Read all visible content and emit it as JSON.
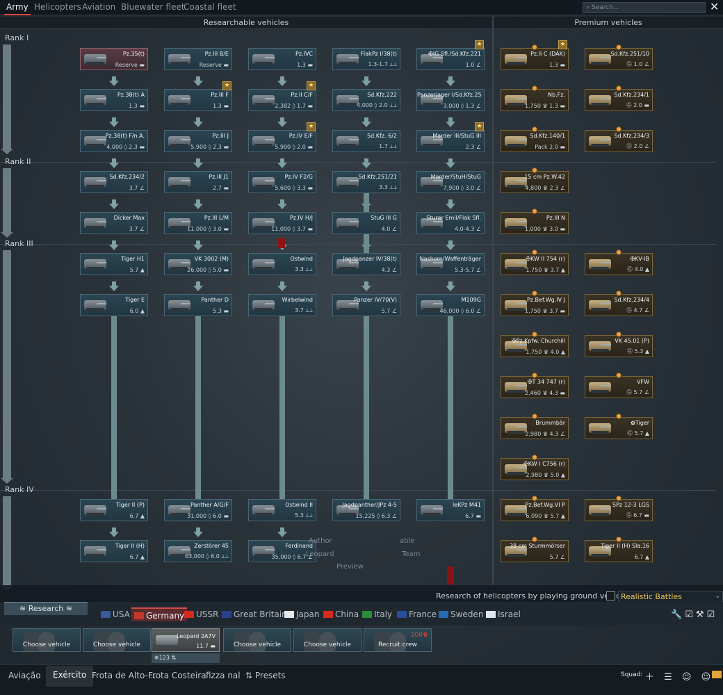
{
  "top_tabs": [
    {
      "label": "Army",
      "active": true
    },
    {
      "label": "Helicopters",
      "active": false
    },
    {
      "label": "Aviation",
      "active": false
    },
    {
      "label": "Bluewater fleet",
      "active": false
    },
    {
      "label": "Coastal fleet",
      "active": false
    }
  ],
  "search_placeholder": "Search...",
  "close_icon": "close-icon",
  "sections": {
    "researchable": "Researchable vehicles",
    "premium": "Premium vehicles"
  },
  "ranks": [
    "Rank I",
    "Rank II",
    "Rank III",
    "Rank IV"
  ],
  "tech_tree": [
    {
      "name": "Pz.35(t)",
      "stats": "Reserve ▬",
      "style": "reserve"
    },
    {
      "name": "Pz.III B/E",
      "stats": "Reserve ▬"
    },
    {
      "name": "Pz.IVC",
      "stats": "1.3 ▬"
    },
    {
      "name": "FlakPz I/38(t)",
      "stats": "1.3-1.7 ⟂⟂"
    },
    {
      "name": "✠IG Sfl./Sd.Kfz.221",
      "stats": "1.0 ∠",
      "badge": true
    },
    {
      "name": "Pz.38(t) A",
      "stats": "1.3 ▬"
    },
    {
      "name": "Pz.III F",
      "stats": "1.3 ▬",
      "badge": true
    },
    {
      "name": "Pz.II C/F",
      "stats": "2,382 ◊ 1.7 ▬",
      "badge": true
    },
    {
      "name": "Sd.Kfz.222",
      "stats": "4,000 ◊ 2.0 ⟂⟂"
    },
    {
      "name": "Panzerjager I/Sd.Kfz.25",
      "stats": "3,000 ◊ 1.3 ∠"
    },
    {
      "name": "Pz.38(t) F/n.A.",
      "stats": "4,000 ◊ 2.3 ▬"
    },
    {
      "name": "Pz.III J",
      "stats": "5,900 ◊ 2.3 ▬"
    },
    {
      "name": "Pz.IV E/F",
      "stats": "5,900 ◊ 2.0 ▬",
      "badge": true
    },
    {
      "name": "Sd.Kfz. 6/2",
      "stats": "1.7 ⟂⟂"
    },
    {
      "name": "Marder III/StuG III",
      "stats": "2.3 ∠",
      "badge": true
    },
    {
      "name": "Sd.Kfz.234/2",
      "stats": "3.7 ∠"
    },
    {
      "name": "Pz.III J1",
      "stats": "2.7 ▬"
    },
    {
      "name": "Pz.IV F2/G",
      "stats": "5,600 ◊ 3.3 ▬"
    },
    {
      "name": "Sd.Kfz.251/21",
      "stats": "3.3 ⟂⟂"
    },
    {
      "name": "Marder/StuH/StuG",
      "stats": "7,900 ◊ 3.0 ∠"
    },
    {
      "name": "Dicker Max",
      "stats": "3.7 ∠"
    },
    {
      "name": "Pz.III L/M",
      "stats": "11,000 ◊ 3.0 ▬"
    },
    {
      "name": "Pz.IV H/J",
      "stats": "11,000 ◊ 3.7 ▬"
    },
    {
      "name": "StuG III G",
      "stats": "4.0 ∠"
    },
    {
      "name": "Sturer Emil/Flak Sfl.",
      "stats": "4.0-4.3 ∠"
    },
    {
      "name": "Tiger H1",
      "stats": "5.7 ▲"
    },
    {
      "name": "VK 3002 (M)",
      "stats": "26,000 ◊ 5.0 ▬"
    },
    {
      "name": "Ostwind",
      "stats": "3.3 ⟂⟂"
    },
    {
      "name": "Jagdpanzer IV/38(t)",
      "stats": "4.3 ∠"
    },
    {
      "name": "Nashorn/Waffenträger",
      "stats": "5.3-5.7 ∠"
    },
    {
      "name": "Tiger E",
      "stats": "6.0 ▲"
    },
    {
      "name": "Panther D",
      "stats": "5.3 ▬"
    },
    {
      "name": "Wirbelwind",
      "stats": "3.7 ⟂⟂"
    },
    {
      "name": "Panzer IV/70(V)",
      "stats": "5.7 ∠"
    },
    {
      "name": "M109G",
      "stats": "46,000 ◊ 6.0 ∠"
    },
    {
      "name": "Tiger II (P)",
      "stats": "6.7 ▲"
    },
    {
      "name": "Panther A/G/F",
      "stats": "31,000 ◊ 6.0 ▬"
    },
    {
      "name": "Ostwind II",
      "stats": "5.3 ⟂⟂"
    },
    {
      "name": "Jagdpanther/JPz 4-5",
      "stats": "15,225 ◊ 6.3 ∠"
    },
    {
      "name": "leKPz M41",
      "stats": "6.7 ▬"
    },
    {
      "name": "Tiger II (H)",
      "stats": "6.7 ▲"
    },
    {
      "name": "Zerstörer 45",
      "stats": "63,000 ◊ 6.0 ⟂⟂"
    },
    {
      "name": "Ferdinand",
      "stats": "35,000 ◊ 6.7 ∠"
    }
  ],
  "premium": [
    {
      "name": "Pz.II C (DAK)",
      "stats": "1.3 ▬",
      "badge": true
    },
    {
      "name": "Sd.Kfz.251/10",
      "stats": "Ⓖ 1.0 ∠"
    },
    {
      "name": "Nb.Fz.",
      "stats": "1,750 ♛ 1.3 ▬"
    },
    {
      "name": "Sd.Kfz.234/1",
      "stats": "Ⓖ 2.0 ▬"
    },
    {
      "name": "Sd.Kfz.140/1",
      "stats": "Pack 2.0 ▬"
    },
    {
      "name": "Sd.Kfz.234/3",
      "stats": "Ⓖ 2.0 ∠"
    },
    {
      "name": "15 cm Pz.W.42",
      "stats": "4,800 ♛ 2.3 ∠"
    },
    {
      "name": "Pz.III N",
      "stats": "1,000 ♛ 3.0 ▬"
    },
    {
      "name": "✠KW II 754 (r)",
      "stats": "1,750 ♛ 3.7 ▲"
    },
    {
      "name": "✠KV-IB",
      "stats": "Ⓖ 4.0 ▲"
    },
    {
      "name": "Pz.Bef.Wg.IV J",
      "stats": "1,750 ♛ 3.7 ▬"
    },
    {
      "name": "Sd.Kfz.234/4",
      "stats": "Ⓖ 4.7 ∠"
    },
    {
      "name": "✠Pz.Kpfw. Churchill",
      "stats": "1,750 ♛ 4.0 ▲"
    },
    {
      "name": "VK 45.01 (P)",
      "stats": "Ⓖ 5.3 ▲"
    },
    {
      "name": "✠T 34 747 (r)",
      "stats": "2,460 ♛ 4.3 ▬"
    },
    {
      "name": "VFW",
      "stats": "Ⓖ 5.7 ∠"
    },
    {
      "name": "Brummbär",
      "stats": "2,980 ♛ 4.3 ∠"
    },
    {
      "name": "✿Tiger",
      "stats": "Ⓖ 5.7 ▲"
    },
    {
      "name": "✠KW I C756 (r)",
      "stats": "2,980 ♛ 5.0 ▲"
    },
    {
      "name": "Pz.Bef.Wg.VI P",
      "stats": "6,090 ♛ 5.7 ▲"
    },
    {
      "name": "SPz 12-3 LGS",
      "stats": "Ⓖ 6.7 ▬"
    },
    {
      "name": "38 cm Sturmmörser",
      "stats": "5.7 ∠"
    },
    {
      "name": "Tiger II (H) Sla.16",
      "stats": "6.7 ▲"
    }
  ],
  "ghost_text": {
    "line1": "Author",
    "line1b": "able",
    "line2": "Leopard",
    "line2b": "Team",
    "preview": "Preview"
  },
  "helicopter_option": "Research of helicopters by playing ground vehicles",
  "game_mode": "Realistic Battles",
  "research_label": "Research",
  "nations": [
    {
      "name": "USA",
      "flag": "#3c5a9a"
    },
    {
      "name": "Germany",
      "flag": "#c23a2b",
      "selected": true
    },
    {
      "name": "USSR",
      "flag": "#d42a1e"
    },
    {
      "name": "Great Britain",
      "flag": "#2b3f8a"
    },
    {
      "name": "Japan",
      "flag": "#e9e9e9"
    },
    {
      "name": "China",
      "flag": "#d52b1e"
    },
    {
      "name": "Italy",
      "flag": "#2d8c3c"
    },
    {
      "name": "France",
      "flag": "#2a4c9c"
    },
    {
      "name": "Sweden",
      "flag": "#2869b4"
    },
    {
      "name": "Israel",
      "flag": "#dfe6f0"
    }
  ],
  "crew_slots": [
    {
      "label": "Choose vehicle"
    },
    {
      "label": "Choose vehicle"
    },
    {
      "vehicle": "Leopard 2A7V",
      "rating": "11.7 ▬",
      "selected": true
    },
    {
      "label": "Choose vehicle"
    },
    {
      "label": "Choose vehicle"
    },
    {
      "label": "Recruit crew",
      "cost": "200♛"
    }
  ],
  "crew_sub": "❄123   ⇅",
  "bottom_tabs": [
    {
      "label": "Aviação"
    },
    {
      "label": "Exército",
      "selected": true
    },
    {
      "label": "Frota de Alto-..."
    },
    {
      "label": "Frota Costeira"
    },
    {
      "label": "fizza nal"
    },
    {
      "label": "⇅ Presets"
    }
  ],
  "squad_label": "Squad:",
  "bottom_icons": "＋ ☰ ☺ ☺"
}
